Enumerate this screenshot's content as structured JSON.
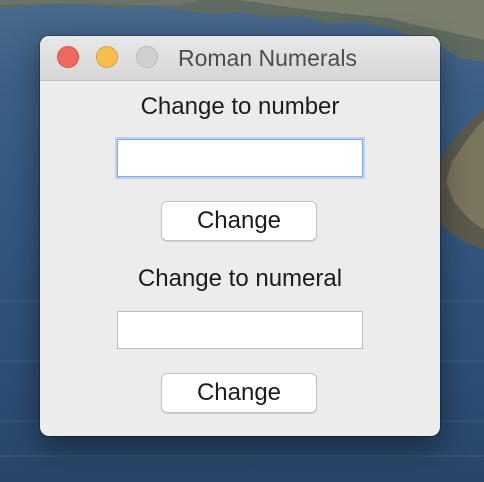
{
  "window": {
    "title": "Roman Numerals",
    "traffic_lights": {
      "close": {
        "icon": "close-traffic-light-icon",
        "color": "#ee6a5f"
      },
      "minimize": {
        "icon": "minimize-traffic-light-icon",
        "color": "#f5be4f"
      },
      "maximize": {
        "icon": "maximize-traffic-light-icon",
        "color": "#d0d0d0"
      }
    }
  },
  "to_number": {
    "label": "Change to number",
    "input_value": "",
    "button_label": "Change"
  },
  "to_numeral": {
    "label": "Change to numeral",
    "input_value": "",
    "button_label": "Change"
  }
}
